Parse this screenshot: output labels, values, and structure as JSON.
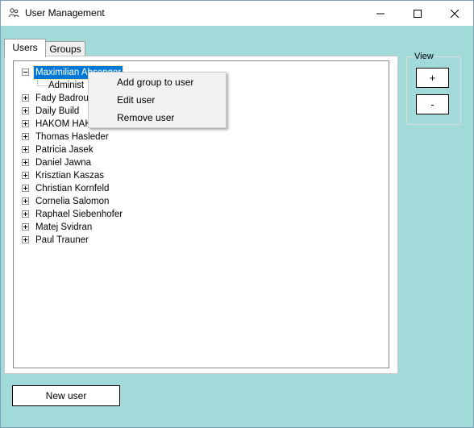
{
  "window": {
    "title": "User Management"
  },
  "tabs": [
    {
      "label": "Users"
    },
    {
      "label": "Groups"
    }
  ],
  "tree": {
    "nodes": [
      {
        "label": "Maximilian Absenger",
        "expanded": true,
        "selected": true
      },
      {
        "label": "Fady Badrou"
      },
      {
        "label": "Daily Build"
      },
      {
        "label": "HAKOM HAKO"
      },
      {
        "label": "Thomas Hasleder"
      },
      {
        "label": "Patricia Jasek"
      },
      {
        "label": "Daniel Jawna"
      },
      {
        "label": "Krisztian Kaszas"
      },
      {
        "label": "Christian Kornfeld"
      },
      {
        "label": "Cornelia Salomon"
      },
      {
        "label": "Raphael Siebenhofer"
      },
      {
        "label": "Matej Svidran"
      },
      {
        "label": "Paul Trauner"
      }
    ],
    "child": {
      "label": "Administ"
    }
  },
  "context_menu": {
    "items": [
      {
        "label": "Add group to user"
      },
      {
        "label": "Edit user"
      },
      {
        "label": "Remove user"
      }
    ]
  },
  "view": {
    "label": "View",
    "plus_label": "+",
    "minus_label": "-"
  },
  "buttons": {
    "new_user": "New user"
  },
  "colors": {
    "background": "#a2d9d9",
    "selection": "#0078d7",
    "menu_bg": "#f2f2f2"
  }
}
